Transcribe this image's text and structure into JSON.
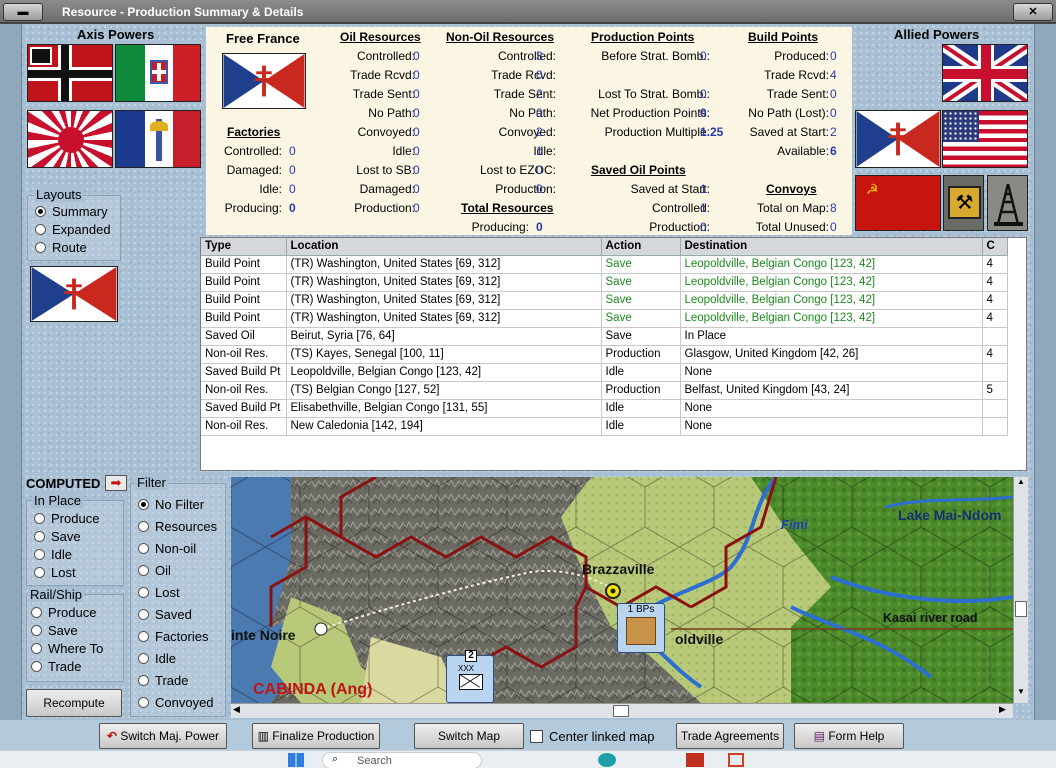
{
  "window": {
    "title": "Resource - Production Summary & Details"
  },
  "left": {
    "axis_title": "Axis Powers",
    "layouts_title": "Layouts",
    "layouts": [
      "Summary",
      "Expanded",
      "Route"
    ],
    "layout_selected": "Summary"
  },
  "right": {
    "allied_title": "Allied Powers"
  },
  "summary": {
    "country": "Free France",
    "factories": {
      "title": "Factories",
      "rows": [
        {
          "label": "Controlled:",
          "value": "0"
        },
        {
          "label": "Damaged:",
          "value": "0"
        },
        {
          "label": "Idle:",
          "value": "0"
        },
        {
          "label": "Producing:",
          "value": "0"
        }
      ]
    },
    "oil": {
      "title": "Oil Resources",
      "rows": [
        {
          "label": "Controlled:",
          "value": "0"
        },
        {
          "label": "Trade Rcvd:",
          "value": "0"
        },
        {
          "label": "Trade Sent:",
          "value": "0"
        },
        {
          "label": "No Path:",
          "value": "0"
        },
        {
          "label": "Convoyed:",
          "value": "0"
        },
        {
          "label": "Idle:",
          "value": "0"
        },
        {
          "label": "Lost to SB:",
          "value": "0"
        },
        {
          "label": "Damaged:",
          "value": "0"
        },
        {
          "label": "Production:",
          "value": "0"
        }
      ]
    },
    "nonoil": {
      "title": "Non-Oil Resources",
      "rows": [
        {
          "label": "Controlled:",
          "value": "3"
        },
        {
          "label": "Trade Rcvd:",
          "value": "0"
        },
        {
          "label": "Trade Sent:",
          "value": "2"
        },
        {
          "label": "No Path:",
          "value": "0"
        },
        {
          "label": "Convoyed:",
          "value": "2"
        },
        {
          "label": "Idle:",
          "value": "1"
        },
        {
          "label": "Lost to EZOC:",
          "value": "0"
        },
        {
          "label": "Production:",
          "value": "0"
        }
      ]
    },
    "total": {
      "title": "Total Resources",
      "label": "Producing:",
      "value": "0"
    },
    "pp": {
      "title": "Production Points",
      "rows": [
        {
          "label": "Before Strat. Bomb.:",
          "value": "0"
        },
        {
          "label": "Lost To Strat. Bomb.:",
          "value": "0"
        },
        {
          "label": "Net Production Points:",
          "value": "0"
        },
        {
          "label": "Production Multiple:",
          "value": "1.25"
        }
      ]
    },
    "saved_oil": {
      "title": "Saved Oil Points",
      "rows": [
        {
          "label": "Saved at Start:",
          "value": "1"
        },
        {
          "label": "Controlled:",
          "value": "1"
        },
        {
          "label": "Production:",
          "value": "0"
        }
      ]
    },
    "bp": {
      "title": "Build Points",
      "rows": [
        {
          "label": "Produced:",
          "value": "0"
        },
        {
          "label": "Trade Rcvd:",
          "value": "4"
        },
        {
          "label": "Trade Sent:",
          "value": "0"
        },
        {
          "label": "No Path (Lost):",
          "value": "0"
        },
        {
          "label": "Saved at Start:",
          "value": "2"
        },
        {
          "label": "Available:",
          "value": "6"
        }
      ]
    },
    "convoys": {
      "title": "Convoys",
      "rows": [
        {
          "label": "Total on Map:",
          "value": "8"
        },
        {
          "label": "Total Unused:",
          "value": "0"
        }
      ]
    }
  },
  "table": {
    "headers": [
      "Type",
      "Location",
      "Action",
      "Destination",
      "C"
    ],
    "rows": [
      [
        "Build Point",
        "(TR) Washington, United States [69, 312]",
        "Save",
        "Leopoldville, Belgian Congo [123, 42]",
        "4"
      ],
      [
        "Build Point",
        "(TR) Washington, United States [69, 312]",
        "Save",
        "Leopoldville, Belgian Congo [123, 42]",
        "4"
      ],
      [
        "Build Point",
        "(TR) Washington, United States [69, 312]",
        "Save",
        "Leopoldville, Belgian Congo [123, 42]",
        "4"
      ],
      [
        "Build Point",
        "(TR) Washington, United States [69, 312]",
        "Save",
        "Leopoldville, Belgian Congo [123, 42]",
        "4"
      ],
      [
        "Saved Oil",
        "Beirut, Syria [76, 64]",
        "Save",
        "In Place",
        ""
      ],
      [
        "Non-oil Res.",
        "(TS) Kayes, Senegal [100, 11]",
        "Production",
        "Glasgow, United Kingdom [42, 26]",
        "4"
      ],
      [
        "Saved Build Pt",
        "Leopoldville, Belgian Congo [123, 42]",
        "Idle",
        "None",
        ""
      ],
      [
        "Non-oil Res.",
        "(TS) Belgian Congo [127, 52]",
        "Production",
        "Belfast, United Kingdom [43, 24]",
        "5"
      ],
      [
        "Saved Build Pt",
        "Elisabethville, Belgian Congo [131, 55]",
        "Idle",
        "None",
        ""
      ],
      [
        "Non-oil Res.",
        "New Caledonia [142, 194]",
        "Idle",
        "None",
        ""
      ]
    ]
  },
  "computed": {
    "label": "COMPUTED",
    "inplace_title": "In Place",
    "inplace": [
      "Produce",
      "Save",
      "Idle",
      "Lost"
    ],
    "railship_title": "Rail/Ship",
    "railship": [
      "Produce",
      "Save",
      "Where To",
      "Trade"
    ],
    "recompute": "Recompute"
  },
  "filter": {
    "title": "Filter",
    "options": [
      "No Filter",
      "Resources",
      "Non-oil",
      "Oil",
      "Lost",
      "Saved",
      "Factories",
      "Idle",
      "Trade",
      "Convoyed"
    ],
    "selected": "No Filter"
  },
  "map": {
    "brazzaville": "Brazzaville",
    "pointe_noire": "inte Noire",
    "leopoldville": "oldville",
    "lake": "Lake Mai-Ndom",
    "kasai": "Kasai river road",
    "fimi": "Fimi",
    "cabinda": "CABINDA (Ang)",
    "bps": "1 BPs",
    "stack": "2",
    "unit": "XXX"
  },
  "bottom": {
    "switch_major": "Switch Maj. Power",
    "finalize": "Finalize Production",
    "switch_map": "Switch Map",
    "center_linked": "Center linked map",
    "trade": "Trade Agreements",
    "help": "Form Help"
  },
  "taskbar": {
    "search": "Search"
  },
  "colors": {
    "value_blue": "#2a3ab0",
    "save_green": "#1d8a1d",
    "hex_border": "#8b1010",
    "ff_blue": "#1f3f8c",
    "ff_red": "#c8281e"
  }
}
